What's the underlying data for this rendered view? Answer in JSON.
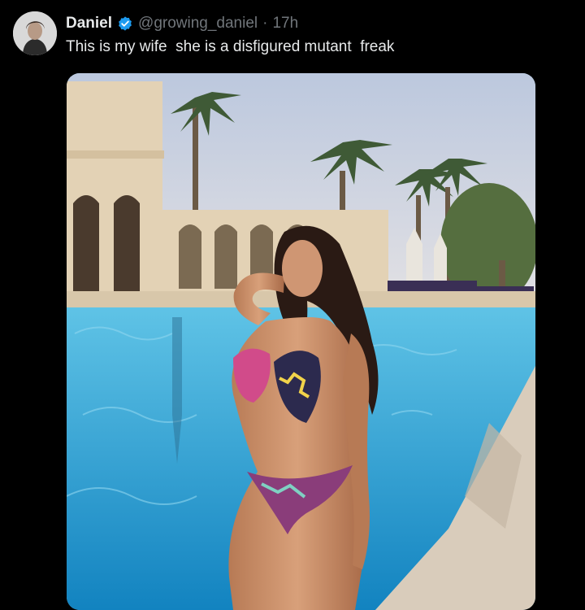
{
  "author": {
    "display_name": "Daniel",
    "handle": "@growing_daniel",
    "separator": "·",
    "time_ago": "17h",
    "verified": true,
    "avatar_icon": "profile-photo-icon"
  },
  "tweet": {
    "text": "This is my wife  she is a disfigured mutant  freak"
  },
  "media": {
    "icon": "photo-pool-scene",
    "colors": {
      "sky": "#c9d4e6",
      "pool": "#2fa6d6",
      "pool_deep": "#1283c0",
      "stone": "#e3d2b5",
      "palm": "#3f5a36",
      "skin": "#c98f6a",
      "hair": "#2a1a14"
    }
  },
  "colors": {
    "background": "#000000",
    "text": "#e7e9ea",
    "muted": "#71767b",
    "verified_badge": "#1d9bf0"
  }
}
